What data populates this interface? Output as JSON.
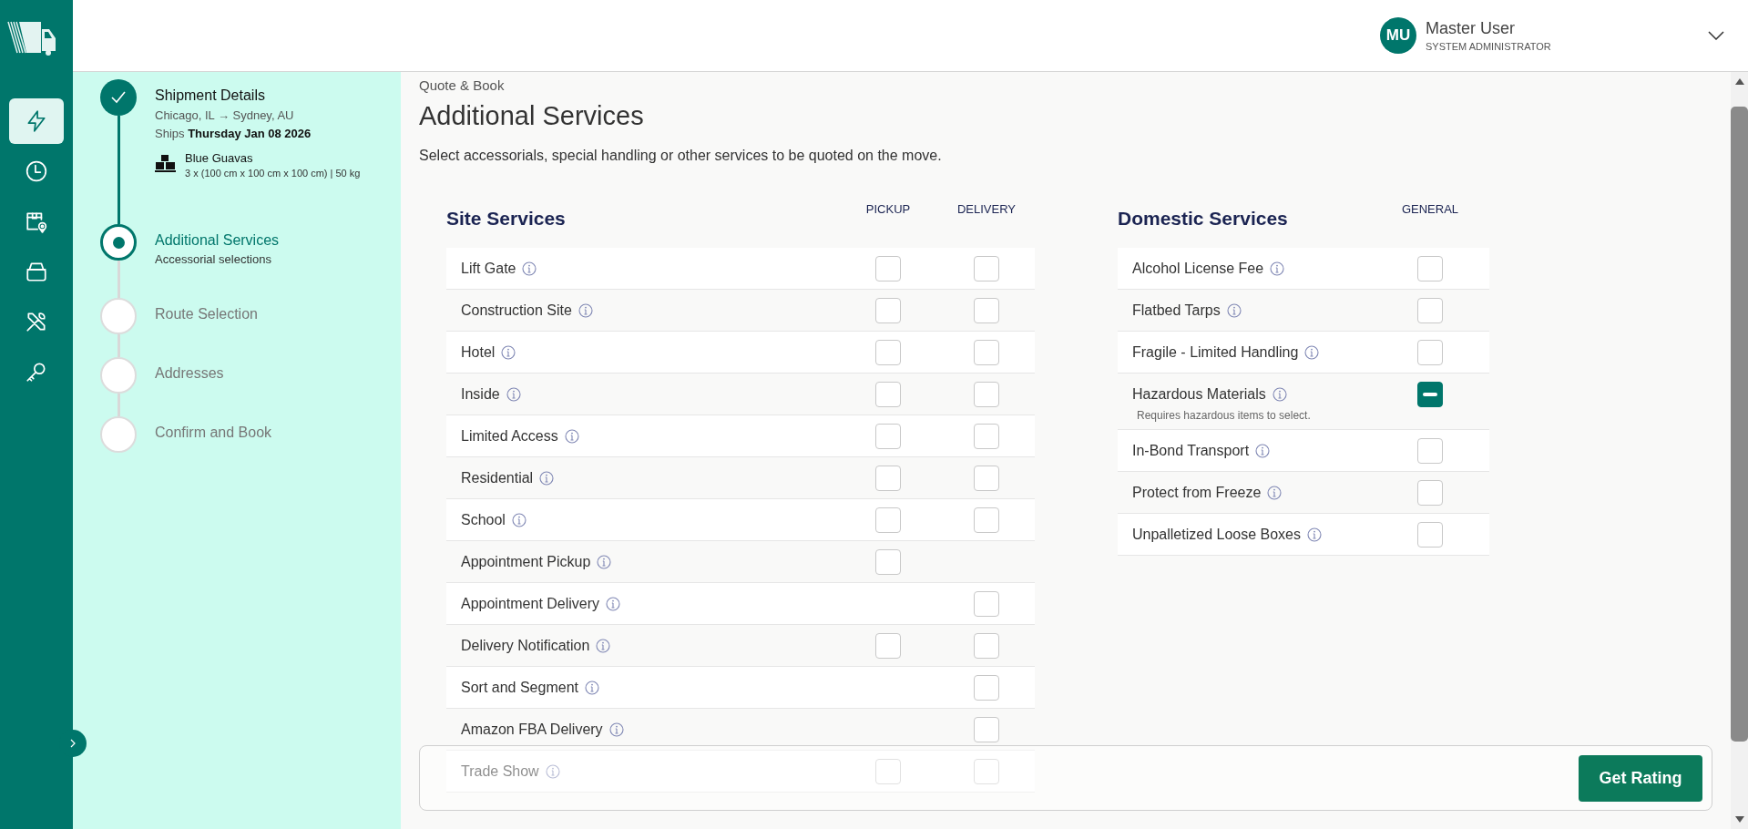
{
  "nav_items": [
    {
      "selected": true
    },
    {
      "selected": false
    },
    {
      "selected": false
    },
    {
      "selected": false
    },
    {
      "selected": false
    },
    {
      "selected": false
    }
  ],
  "user": {
    "initials": "MU",
    "name": "Master User",
    "role": "SYSTEM ADMINISTRATOR"
  },
  "steps": [
    {
      "title": "Shipment Details",
      "completed": true,
      "route": "Chicago, IL → Sydney, AU",
      "ships": "Ships **Thursday Jan 08 2026**",
      "item_name": "Blue Guavas",
      "item_details": "3 x (100 cm x 100 cm x 100 cm) | 50 kg"
    },
    {
      "title": "Additional Services",
      "completed": false,
      "selected": true,
      "subtitle": "Accessorial selections"
    },
    {
      "title": "Route Selection",
      "completed": false,
      "selected": false
    },
    {
      "title": "Addresses",
      "completed": false,
      "selected": false
    },
    {
      "title": "Confirm and Book",
      "completed": false,
      "selected": false
    }
  ],
  "breadcrumb": "Quote & Book",
  "title": "Additional Services",
  "description": "Select accessorials, special handling or other services to be quoted on the move.",
  "site_services": {
    "heading": "Site Services",
    "columns": [
      "PICKUP",
      "DELIVERY"
    ],
    "rows": [
      {
        "label": "Lift Gate",
        "pickup": {
          "checked": false
        },
        "delivery": {
          "checked": false
        }
      },
      {
        "label": "Construction Site",
        "pickup": {
          "checked": false
        },
        "delivery": {
          "checked": false
        }
      },
      {
        "label": "Hotel",
        "pickup": {
          "checked": false
        },
        "delivery": {
          "checked": false
        }
      },
      {
        "label": "Inside",
        "pickup": {
          "checked": false
        },
        "delivery": {
          "checked": false
        }
      },
      {
        "label": "Limited Access",
        "pickup": {
          "checked": false
        },
        "delivery": {
          "checked": false
        }
      },
      {
        "label": "Residential",
        "pickup": {
          "checked": false
        },
        "delivery": {
          "checked": false
        }
      },
      {
        "label": "School",
        "pickup": {
          "checked": false
        },
        "delivery": {
          "checked": false
        }
      },
      {
        "label": "Appointment Pickup",
        "pickup": {
          "checked": false
        }
      },
      {
        "label": "Appointment Delivery",
        "delivery": {
          "checked": false
        }
      },
      {
        "label": "Delivery Notification",
        "pickup": {
          "checked": false
        },
        "delivery": {
          "checked": false
        }
      },
      {
        "label": "Sort and Segment",
        "delivery": {
          "checked": false
        }
      },
      {
        "label": "Amazon FBA Delivery",
        "delivery": {
          "checked": false
        }
      },
      {
        "label": "Trade Show",
        "pickup": {
          "checked": false
        },
        "delivery": {
          "checked": false
        }
      }
    ]
  },
  "domestic_services": {
    "heading": "Domestic Services",
    "columns": [
      "GENERAL"
    ],
    "rows": [
      {
        "label": "Alcohol License Fee",
        "checked": false,
        "indeterminate": false
      },
      {
        "label": "Flatbed Tarps",
        "checked": false,
        "indeterminate": false
      },
      {
        "label": "Fragile - Limited Handling",
        "checked": false,
        "indeterminate": false
      },
      {
        "label": "Hazardous Materials",
        "indeterminate": true,
        "note": "Requires hazardous items to select."
      },
      {
        "label": "In-Bond Transport",
        "checked": false,
        "indeterminate": false
      },
      {
        "label": "Protect from Freeze",
        "checked": false,
        "indeterminate": false
      },
      {
        "label": "Unpalletized Loose Boxes",
        "checked": false,
        "indeterminate": false
      }
    ]
  },
  "action_button": "Get Rating"
}
